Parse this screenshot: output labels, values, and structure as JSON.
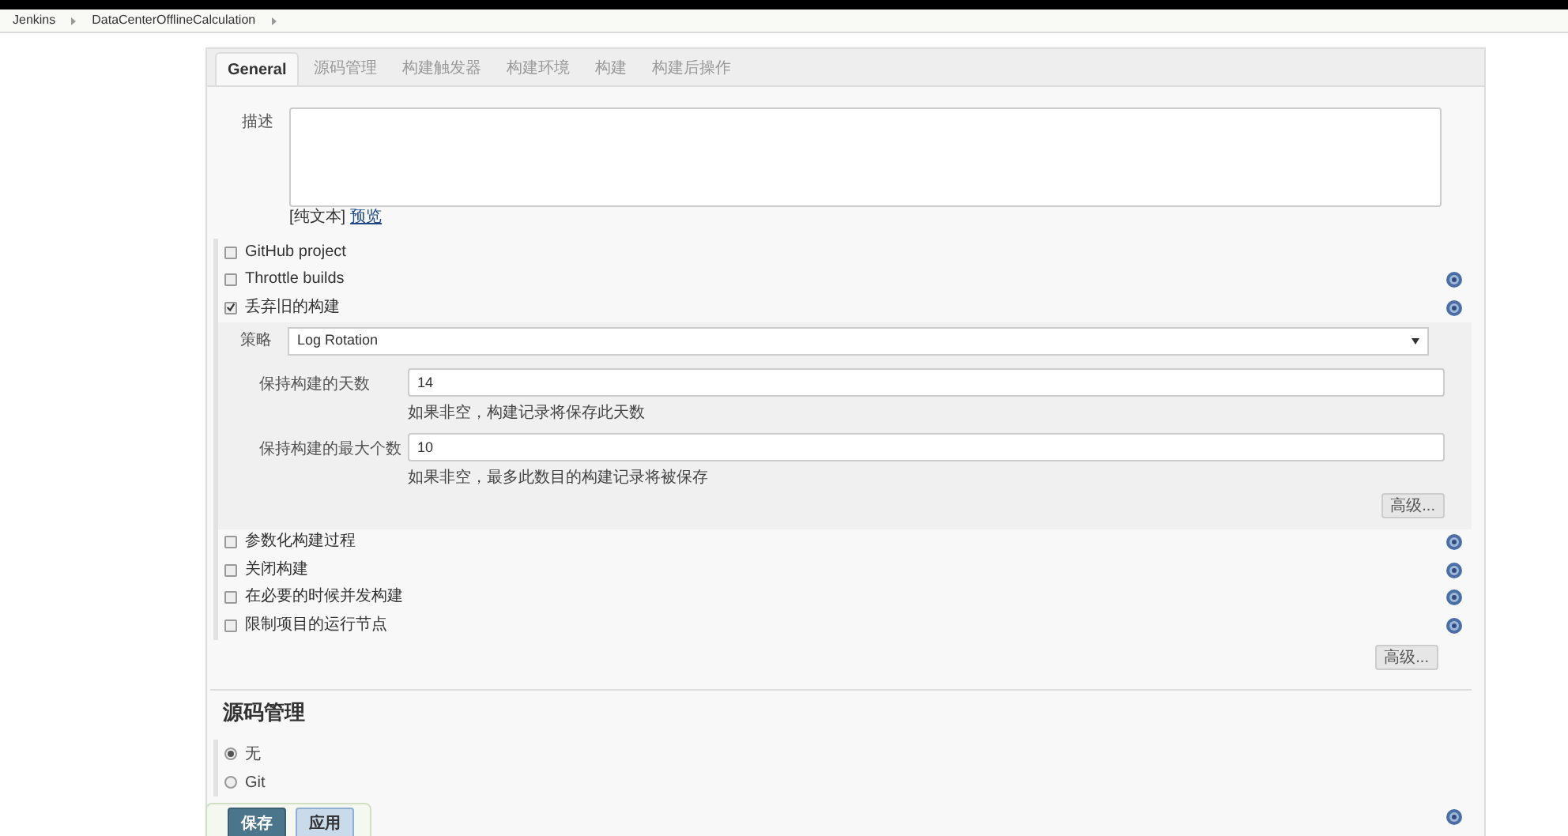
{
  "breadcrumbs": [
    "Jenkins",
    "DataCenterOfflineCalculation"
  ],
  "tabs": [
    {
      "label": "General",
      "selected": true
    },
    {
      "label": "源码管理",
      "selected": false
    },
    {
      "label": "构建触发器",
      "selected": false
    },
    {
      "label": "构建环境",
      "selected": false
    },
    {
      "label": "构建",
      "selected": false
    },
    {
      "label": "构建后操作",
      "selected": false
    }
  ],
  "description": {
    "label": "描述",
    "plain_text": "[纯文本]",
    "preview_link": "预览"
  },
  "options_top": [
    {
      "label": "GitHub project",
      "checked": false,
      "help": false
    },
    {
      "label": "Throttle builds",
      "checked": false,
      "help": true
    },
    {
      "label": "丢弃旧的构建",
      "checked": true,
      "help": true
    }
  ],
  "discard": {
    "strategy_label": "策略",
    "strategy": "Log Rotation",
    "fields": [
      {
        "label": "保持构建的天数",
        "value": "14",
        "hint": "如果非空，构建记录将保存此天数"
      },
      {
        "label": "保持构建的最大个数",
        "value": "10",
        "hint": "如果非空，最多此数目的构建记录将被保存"
      }
    ],
    "advanced": "高级..."
  },
  "options_bottom": [
    {
      "label": "参数化构建过程",
      "checked": false,
      "help": true
    },
    {
      "label": "关闭构建",
      "checked": false,
      "help": true
    },
    {
      "label": "在必要的时候并发构建",
      "checked": false,
      "help": true
    },
    {
      "label": "限制项目的运行节点",
      "checked": false,
      "help": true
    }
  ],
  "advanced": "高级...",
  "scm": {
    "heading": "源码管理",
    "options": [
      {
        "label": "无",
        "selected": true
      },
      {
        "label": "Git",
        "selected": false
      }
    ]
  },
  "buttons": {
    "save": "保存",
    "apply": "应用"
  }
}
